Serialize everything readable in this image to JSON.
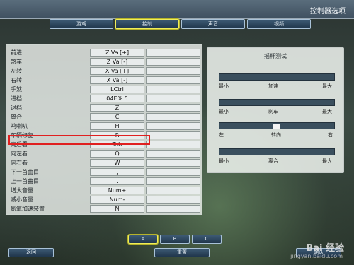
{
  "window": {
    "title": "控制器选项"
  },
  "tabs": [
    {
      "label": "游戏",
      "active": false
    },
    {
      "label": "控制",
      "active": true
    },
    {
      "label": "声音",
      "active": false
    },
    {
      "label": "视频",
      "active": false
    }
  ],
  "bindings": [
    {
      "label": "前进",
      "key": "Z Va [+]"
    },
    {
      "label": "煞车",
      "key": "Z Va [-]"
    },
    {
      "label": "左转",
      "key": "X Va [+]"
    },
    {
      "label": "右转",
      "key": "X Va [-]"
    },
    {
      "label": "手煞",
      "key": "LCtrl"
    },
    {
      "label": "进档",
      "key": "04E% 5"
    },
    {
      "label": "退档",
      "key": "Z"
    },
    {
      "label": "离合",
      "key": "C"
    },
    {
      "label": "鸣喇叭",
      "key": "H"
    },
    {
      "label": "车辆修复",
      "key": "R"
    },
    {
      "label": "向后看",
      "key": "Tab"
    },
    {
      "label": "向左看",
      "key": "Q"
    },
    {
      "label": "向右看",
      "key": "W"
    },
    {
      "label": "下一首曲目",
      "key": ","
    },
    {
      "label": "上一首曲目",
      "key": "."
    },
    {
      "label": "增大音量",
      "key": "Num+"
    },
    {
      "label": "减小音量",
      "key": "Num-"
    },
    {
      "label": "氮氧加速装置",
      "key": "N"
    }
  ],
  "highlighted_row": "进档",
  "joystick_test": {
    "title": "摇杆测试",
    "axes": [
      {
        "left": "最小",
        "center": "加速",
        "right": "最大",
        "type": "range"
      },
      {
        "left": "最小",
        "center": "刹车",
        "right": "最大",
        "type": "range"
      },
      {
        "left": "左",
        "center": "转向",
        "right": "右",
        "type": "center",
        "level": 0.5
      },
      {
        "left": "最小",
        "center": "离合",
        "right": "最大",
        "type": "range"
      }
    ]
  },
  "profiles": [
    {
      "label": "A",
      "active": true
    },
    {
      "label": "B",
      "active": false
    },
    {
      "label": "C",
      "active": false
    }
  ],
  "footer": {
    "back_label": "返回",
    "reset_label": "重置",
    "ok_label": "确认"
  },
  "watermark": {
    "text": "Bai 经验",
    "url": "jingyan.baidu.com"
  }
}
